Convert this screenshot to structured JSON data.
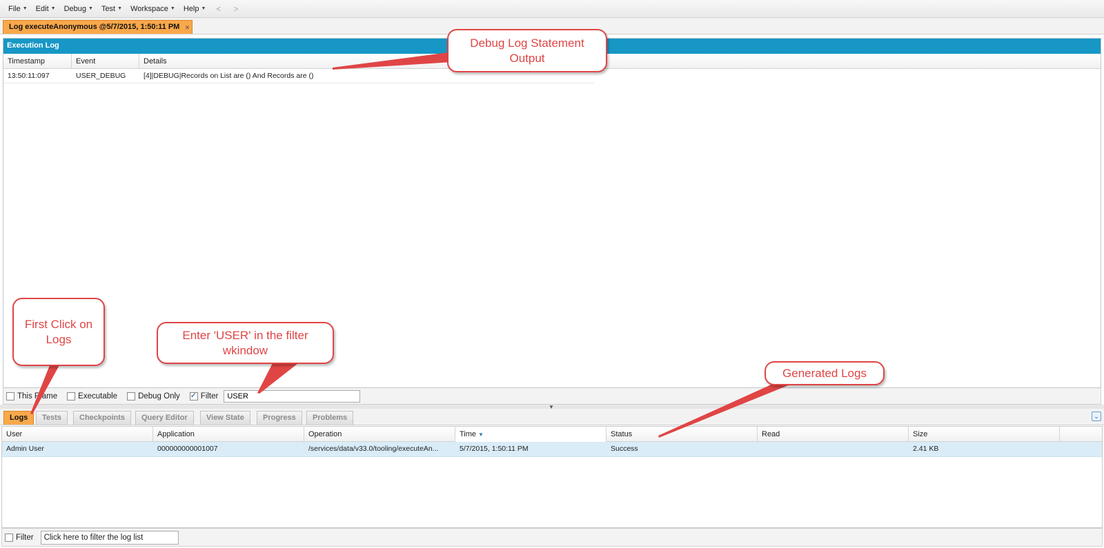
{
  "menu": {
    "items": [
      "File",
      "Edit",
      "Debug",
      "Test",
      "Workspace",
      "Help"
    ],
    "back_arrow": "<",
    "forward_arrow": ">"
  },
  "doc_tab": {
    "label": "Log executeAnonymous @5/7/2015, 1:50:11 PM",
    "close": "✕"
  },
  "exec_log": {
    "title": "Execution Log",
    "columns": [
      "Timestamp",
      "Event",
      "Details"
    ],
    "rows": [
      {
        "timestamp": "13:50:11:097",
        "event": "USER_DEBUG",
        "details": "[4]|DEBUG|Records on List are () And Records are ()"
      }
    ]
  },
  "exec_filter": {
    "this_frame": "This Frame",
    "executable": "Executable",
    "debug_only": "Debug Only",
    "filter": "Filter",
    "filter_value": "USER"
  },
  "bottom_tabs": [
    "Logs",
    "Tests",
    "Checkpoints",
    "Query Editor",
    "View State",
    "Progress",
    "Problems"
  ],
  "logs": {
    "columns": [
      "User",
      "Application",
      "Operation",
      "Time",
      "Status",
      "Read",
      "Size"
    ],
    "rows": [
      {
        "user": "Admin User",
        "application": "000000000001007",
        "operation": "/services/data/v33.0/tooling/executeAn...",
        "time": "5/7/2015, 1:50:11 PM",
        "status": "Success",
        "read": "",
        "size": "2.41 KB"
      }
    ],
    "filter_label": "Filter",
    "filter_placeholder": "Click here to filter the log list"
  },
  "callouts": {
    "debug_output": "Debug Log Statement Output",
    "first_click": "First Click on Logs",
    "enter_user": "Enter 'USER' in the filter wkindow",
    "generated_logs": "Generated Logs"
  },
  "colors": {
    "accent_orange": "#f9a84a",
    "header_blue": "#1797c5",
    "callout_red": "#e04545",
    "row_selected": "#d9ecf7"
  }
}
